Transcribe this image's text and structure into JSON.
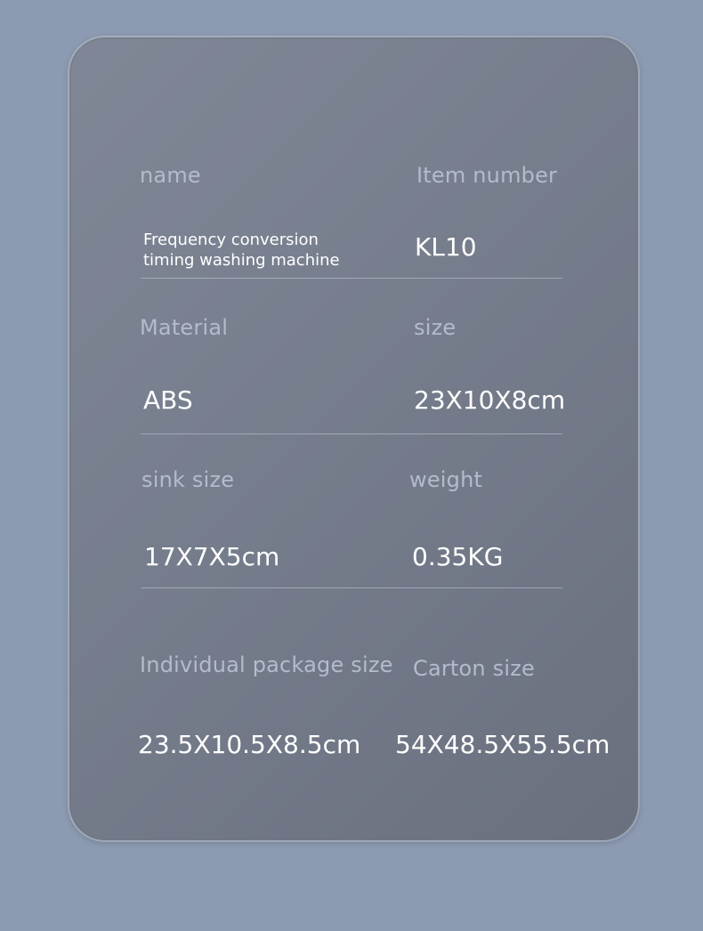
{
  "specs": {
    "row1": {
      "left_label": "name",
      "left_value_line1": "Frequency conversion",
      "left_value_line2": "timing washing machine",
      "right_label": "Item number",
      "right_value": "KL10"
    },
    "row2": {
      "left_label": "Material",
      "left_value": "ABS",
      "right_label": "size",
      "right_value": "23X10X8cm"
    },
    "row3": {
      "left_label": "sink size",
      "left_value": "17X7X5cm",
      "right_label": "weight",
      "right_value": "0.35KG"
    },
    "row4": {
      "left_label": "Individual package size",
      "left_value": "23.5X10.5X8.5cm",
      "right_label": "Carton size",
      "right_value": "54X48.5X55.5cm"
    }
  },
  "colors": {
    "background": "#8c9bb1",
    "card": "#767d8c",
    "label_text": "#b3bccd",
    "value_text": "#ffffff"
  }
}
